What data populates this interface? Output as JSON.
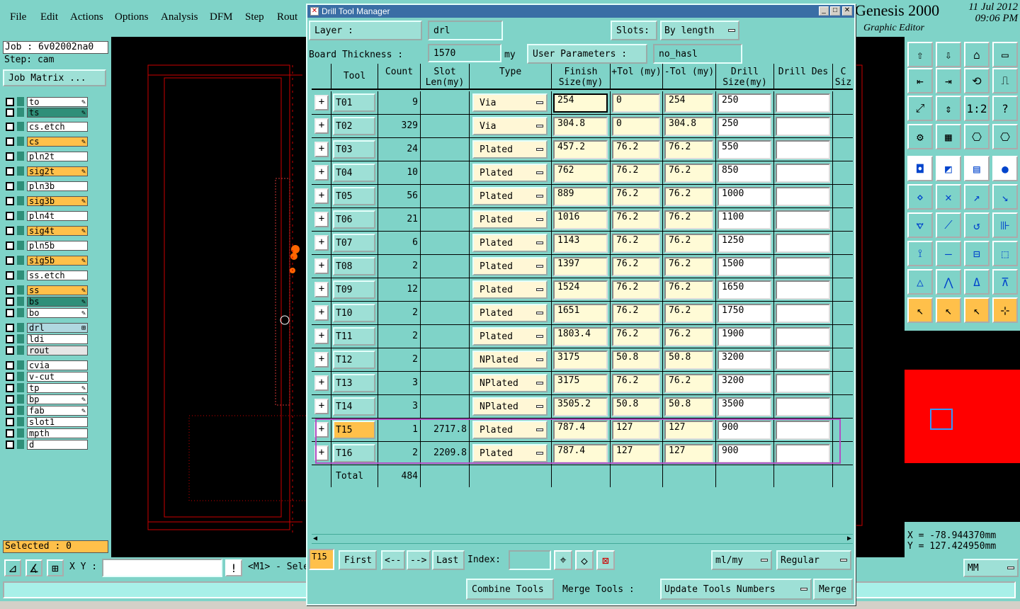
{
  "menubar": {
    "items": [
      "File",
      "Edit",
      "Actions",
      "Options",
      "Analysis",
      "DFM",
      "Step",
      "Rout"
    ]
  },
  "brand": {
    "title": "Genesis 2000",
    "subtitle": "Graphic Editor",
    "date": "11 Jul 2012",
    "time": "09:06 PM"
  },
  "left": {
    "job": "Job : 6v02002na0",
    "step": "Step: cam",
    "job_matrix": "Job Matrix ...",
    "layers": [
      {
        "name": "to",
        "color": "#ffffff",
        "flag": "✎"
      },
      {
        "name": "ts",
        "color": "#2f8f79",
        "flag": "✎"
      },
      {
        "name": "cs.etch",
        "color": "#ffffff",
        "flag": ""
      },
      {
        "name": "cs",
        "color": "#ffc04a",
        "flag": "✎"
      },
      {
        "name": "pln2t",
        "color": "#ffffff",
        "flag": ""
      },
      {
        "name": "sig2t",
        "color": "#ffc04a",
        "flag": "✎"
      },
      {
        "name": "pln3b",
        "color": "#ffffff",
        "flag": ""
      },
      {
        "name": "sig3b",
        "color": "#ffc04a",
        "flag": "✎"
      },
      {
        "name": "pln4t",
        "color": "#ffffff",
        "flag": ""
      },
      {
        "name": "sig4t",
        "color": "#ffc04a",
        "flag": "✎"
      },
      {
        "name": "pln5b",
        "color": "#ffffff",
        "flag": ""
      },
      {
        "name": "sig5b",
        "color": "#ffc04a",
        "flag": "✎"
      },
      {
        "name": "ss.etch",
        "color": "#ffffff",
        "flag": ""
      },
      {
        "name": "ss",
        "color": "#ffc04a",
        "flag": "✎"
      },
      {
        "name": "bs",
        "color": "#2f8f79",
        "flag": "✎"
      },
      {
        "name": "bo",
        "color": "#ffffff",
        "flag": "✎"
      },
      {
        "name": "drl",
        "color": "#b0d8e0",
        "flag": "⊞"
      },
      {
        "name": "ldi",
        "color": "#ffffff",
        "flag": ""
      },
      {
        "name": "rout",
        "color": "#e6e6e6",
        "flag": ""
      },
      {
        "name": "cvia",
        "color": "#ffffff",
        "flag": ""
      },
      {
        "name": "v-cut",
        "color": "#ffffff",
        "flag": ""
      },
      {
        "name": "tp",
        "color": "#ffffff",
        "flag": "✎"
      },
      {
        "name": "bp",
        "color": "#ffffff",
        "flag": "✎"
      },
      {
        "name": "fab",
        "color": "#ffffff",
        "flag": "✎"
      },
      {
        "name": "slot1",
        "color": "#ffffff",
        "flag": ""
      },
      {
        "name": "mpth",
        "color": "#ffffff",
        "flag": ""
      },
      {
        "name": "d",
        "color": "#ffffff",
        "flag": ""
      }
    ],
    "selected": "Selected : 0"
  },
  "dialog": {
    "title": "Drill Tool Manager",
    "layer_label": "Layer :",
    "layer_value": "drl",
    "slots_label": "Slots:",
    "slots_value": "By length",
    "thickness_label": "Board Thickness :",
    "thickness_value": "1570",
    "thickness_unit": "my",
    "user_params_label": "User Parameters :",
    "user_params_value": "no_hasl",
    "headers": [
      "Tool",
      "Count",
      "Slot Len(my)",
      "Type",
      "Finish Size(my)",
      "+Tol (my)",
      "-Tol (my)",
      "Drill Size(my)",
      "Drill Des",
      "C Siz"
    ],
    "rows": [
      {
        "tool": "T01",
        "count": "9",
        "slot": "",
        "type": "Via",
        "finish": "254",
        "ptol": "0",
        "mtol": "254",
        "drill": "250"
      },
      {
        "tool": "T02",
        "count": "329",
        "slot": "",
        "type": "Via",
        "finish": "304.8",
        "ptol": "0",
        "mtol": "304.8",
        "drill": "250"
      },
      {
        "tool": "T03",
        "count": "24",
        "slot": "",
        "type": "Plated",
        "finish": "457.2",
        "ptol": "76.2",
        "mtol": "76.2",
        "drill": "550"
      },
      {
        "tool": "T04",
        "count": "10",
        "slot": "",
        "type": "Plated",
        "finish": "762",
        "ptol": "76.2",
        "mtol": "76.2",
        "drill": "850"
      },
      {
        "tool": "T05",
        "count": "56",
        "slot": "",
        "type": "Plated",
        "finish": "889",
        "ptol": "76.2",
        "mtol": "76.2",
        "drill": "1000"
      },
      {
        "tool": "T06",
        "count": "21",
        "slot": "",
        "type": "Plated",
        "finish": "1016",
        "ptol": "76.2",
        "mtol": "76.2",
        "drill": "1100"
      },
      {
        "tool": "T07",
        "count": "6",
        "slot": "",
        "type": "Plated",
        "finish": "1143",
        "ptol": "76.2",
        "mtol": "76.2",
        "drill": "1250"
      },
      {
        "tool": "T08",
        "count": "2",
        "slot": "",
        "type": "Plated",
        "finish": "1397",
        "ptol": "76.2",
        "mtol": "76.2",
        "drill": "1500"
      },
      {
        "tool": "T09",
        "count": "12",
        "slot": "",
        "type": "Plated",
        "finish": "1524",
        "ptol": "76.2",
        "mtol": "76.2",
        "drill": "1650"
      },
      {
        "tool": "T10",
        "count": "2",
        "slot": "",
        "type": "Plated",
        "finish": "1651",
        "ptol": "76.2",
        "mtol": "76.2",
        "drill": "1750"
      },
      {
        "tool": "T11",
        "count": "2",
        "slot": "",
        "type": "Plated",
        "finish": "1803.4",
        "ptol": "76.2",
        "mtol": "76.2",
        "drill": "1900"
      },
      {
        "tool": "T12",
        "count": "2",
        "slot": "",
        "type": "NPlated",
        "finish": "3175",
        "ptol": "50.8",
        "mtol": "50.8",
        "drill": "3200"
      },
      {
        "tool": "T13",
        "count": "3",
        "slot": "",
        "type": "NPlated",
        "finish": "3175",
        "ptol": "76.2",
        "mtol": "76.2",
        "drill": "3200"
      },
      {
        "tool": "T14",
        "count": "3",
        "slot": "",
        "type": "NPlated",
        "finish": "3505.2",
        "ptol": "50.8",
        "mtol": "50.8",
        "drill": "3500"
      },
      {
        "tool": "T15",
        "count": "1",
        "slot": "2717.8",
        "type": "Plated",
        "finish": "787.4",
        "ptol": "127",
        "mtol": "127",
        "drill": "900"
      },
      {
        "tool": "T16",
        "count": "2",
        "slot": "2209.8",
        "type": "Plated",
        "finish": "787.4",
        "ptol": "127",
        "mtol": "127",
        "drill": "900"
      }
    ],
    "total_label": "Total",
    "total_count": "484",
    "current_tool": "T15",
    "nav": {
      "first": "First",
      "prev": "<--",
      "next": "-->",
      "last": "Last",
      "index_label": "Index:",
      "units": "ml/my",
      "mode": "Regular"
    },
    "bottom": {
      "combine": "Combine Tools",
      "merge_label": "Merge Tools :",
      "update": "Update Tools Numbers",
      "merge": "Merge"
    }
  },
  "coords": {
    "x": "X  =  -78.944370mm",
    "y": "Y  =  127.424950mm"
  },
  "status": {
    "xy_label": "X Y :",
    "hint": "<M1> - Sele",
    "units": "MM"
  }
}
